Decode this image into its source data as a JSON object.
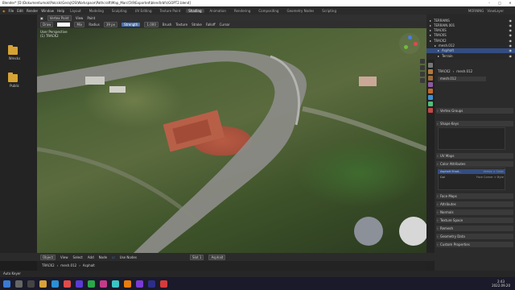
{
  "titlebar": {
    "title": "Blender* [D:\\Dokumentumok\\Palcsik\\Geraj\\OS\\Workspace\\Pathcraft\\Map_Marc\\5\\9\\Exported\\blend\\rbfs\\GOPT2.blend]"
  },
  "menubar": {
    "items": [
      "File",
      "Edit",
      "Render",
      "Window",
      "Help"
    ],
    "tabs": [
      "Layout",
      "Modeling",
      "Sculpting",
      "UV Editing",
      "Texture Paint",
      "Shading",
      "Animation",
      "Rendering",
      "Compositing",
      "Geometry Nodes",
      "Scripting"
    ],
    "active_tab": "Shading",
    "scene_label": "MORNING",
    "view_layer": "ViewLayer"
  },
  "file_browser": {
    "folders": [
      "Wrecks",
      "Public"
    ]
  },
  "editor_header": {
    "mode": "Vertex Paint",
    "view": "View",
    "paint": "Paint",
    "select": "Select"
  },
  "tool_header": {
    "draw": "Draw",
    "mix": "Mix",
    "radius_label": "Radius",
    "radius_value": "39 px",
    "strength_label": "Strength",
    "strength_value": "1.000",
    "brush": "Brush",
    "texture": "Texture",
    "stroke": "Stroke",
    "falloff": "Falloff",
    "cursor": "Cursor"
  },
  "viewport": {
    "overlay_title": "User Perspective",
    "overlay_sub": "(1) TRACK2"
  },
  "outliner": {
    "rows": [
      {
        "label": "TERRAINS",
        "indent": 4,
        "sel": false
      },
      {
        "label": "TERRAIN.001",
        "indent": 4,
        "sel": false
      },
      {
        "label": "TRACKS",
        "indent": 4,
        "sel": false
      },
      {
        "label": "TRACKS",
        "indent": 4,
        "sel": false
      },
      {
        "label": "TRACK2",
        "indent": 4,
        "sel": false
      },
      {
        "label": "mesh.012",
        "indent": 10,
        "sel": false
      },
      {
        "label": "Asphalt",
        "indent": 14,
        "sel": true
      },
      {
        "label": "Terrain",
        "indent": 14,
        "sel": false
      }
    ]
  },
  "properties": {
    "breadcrumb_object": "TRACK2",
    "breadcrumb_mesh": "mesh.012",
    "mesh_name": "mesh.012",
    "panels": [
      "Vertex Groups",
      "Shape Keys",
      "UV Maps",
      "Color Attributes",
      "Face Maps",
      "Attributes",
      "Normals",
      "Texture Space",
      "Remesh",
      "Geometry Data",
      "Custom Properties"
    ],
    "color_attributes": [
      {
        "name": "Asphalt Shad...",
        "domain": "Vertex > Color"
      },
      {
        "name": "Col",
        "domain": "Face Corner > Byte"
      }
    ]
  },
  "statusbar": {
    "mode": "Object",
    "view": "View",
    "select": "Select",
    "add": "Add",
    "node": "Node",
    "use_nodes": "Use Nodes",
    "slot": "Slot 1",
    "material": "Asphalt",
    "breadcrumb": [
      "TRACK2",
      "mesh.012",
      "Asphalt"
    ]
  },
  "bottom": {
    "hint": "Auto Keyer"
  },
  "taskbar": {
    "time": "2:43",
    "date": "2022.09.20"
  },
  "colors": {
    "accent": "#4772b3",
    "selection": "#334d80",
    "folder": "#d6a334"
  }
}
